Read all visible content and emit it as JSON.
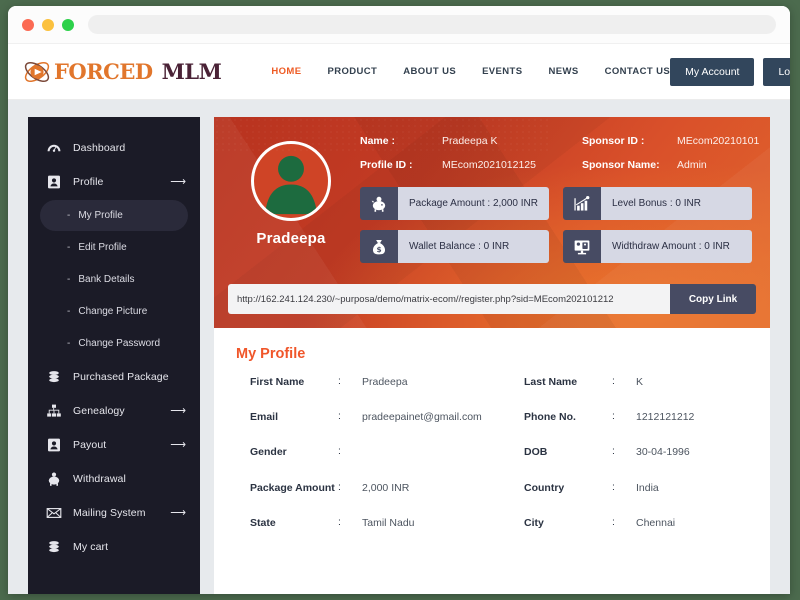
{
  "browser": {
    "dots": [
      "close-red",
      "minimize-yellow",
      "maximize-green"
    ],
    "address_value": ""
  },
  "header": {
    "logo_primary": "FORCED",
    "logo_secondary": "MLM",
    "nav": [
      {
        "label": "HOME",
        "active": true
      },
      {
        "label": "PRODUCT",
        "active": false
      },
      {
        "label": "ABOUT US",
        "active": false
      },
      {
        "label": "EVENTS",
        "active": false
      },
      {
        "label": "NEWS",
        "active": false
      },
      {
        "label": "CONTACT US",
        "active": false
      }
    ],
    "my_account_label": "My Account",
    "logout_label": "Logout"
  },
  "sidebar": {
    "items": [
      {
        "label": "Dashboard",
        "icon": "speedometer-icon",
        "arrow": ""
      },
      {
        "label": "Profile",
        "icon": "id-card-icon",
        "arrow": "⟶"
      }
    ],
    "sub_items": [
      {
        "label": "My Profile",
        "dash": "-",
        "active": true
      },
      {
        "label": "Edit Profile",
        "dash": "-",
        "active": false
      },
      {
        "label": "Bank Details",
        "dash": "-",
        "active": false
      },
      {
        "label": "Change Picture",
        "dash": "-",
        "active": false
      },
      {
        "label": "Change Password",
        "dash": "-",
        "active": false
      }
    ],
    "items_after": [
      {
        "label": "Purchased Package",
        "icon": "coins-icon",
        "arrow": ""
      },
      {
        "label": "Genealogy",
        "icon": "hierarchy-icon",
        "arrow": "⟶"
      },
      {
        "label": "Payout",
        "icon": "id-card-icon",
        "arrow": "⟶"
      },
      {
        "label": "Withdrawal",
        "icon": "piggy-bank-icon",
        "arrow": ""
      },
      {
        "label": "Mailing System",
        "icon": "envelope-icon",
        "arrow": "⟶"
      },
      {
        "label": "My cart",
        "icon": "coins-icon",
        "arrow": ""
      }
    ]
  },
  "hero": {
    "avatar_name": "Pradeepa",
    "fields": [
      {
        "key": "Name :",
        "value": "Pradeepa K"
      },
      {
        "key": "Sponsor ID :",
        "value": "MEcom20210101"
      },
      {
        "key": "Profile ID :",
        "value": "MEcom2021012125"
      },
      {
        "key": "Sponsor Name:",
        "value": "Admin"
      }
    ],
    "stats": [
      {
        "label": "Package Amount : 2,000 INR",
        "icon": "piggy-bank-icon"
      },
      {
        "label": "Level Bonus : 0 INR",
        "icon": "bar-chart-icon"
      },
      {
        "label": "Wallet Balance : 0 INR",
        "icon": "money-bag-icon"
      },
      {
        "label": "Widthdraw Amount : 0 INR",
        "icon": "monitor-icon"
      }
    ],
    "referral_link": "http://162.241.124.230/~purposa/demo/matrix-ecom//register.php?sid=MEcom202101212",
    "copy_label": "Copy Link"
  },
  "profile": {
    "title": "My Profile",
    "separator": ":",
    "rows": [
      {
        "key1": "First Name",
        "val1": "Pradeepa",
        "key2": "Last Name",
        "val2": "K"
      },
      {
        "key1": "Email",
        "val1": "pradeepainet@gmail.com",
        "key2": "Phone No.",
        "val2": "1212121212"
      },
      {
        "key1": "Gender",
        "val1": "",
        "key2": "DOB",
        "val2": "30-04-1996"
      },
      {
        "key1": "Package Amount",
        "val1": "2,000 INR",
        "key2": "Country",
        "val2": "India"
      },
      {
        "key1": "State",
        "val1": "Tamil Nadu",
        "key2": "City",
        "val2": "Chennai"
      }
    ]
  },
  "colors": {
    "accent_orange": "#ee5b24",
    "logo_orange": "#e1762c",
    "logo_dark": "#4a2236",
    "nav_dark": "#32465c",
    "sidebar_bg": "#1b1b27",
    "page_bg": "#e7eaed",
    "outer_bg": "#4c6b4e",
    "hero_red": "#c33b24",
    "hero_orange": "#e2672c",
    "stat_icon_bg": "#474b63",
    "stat_text_bg": "#d6d8e4",
    "avatar_green": "#1d6b3f"
  }
}
